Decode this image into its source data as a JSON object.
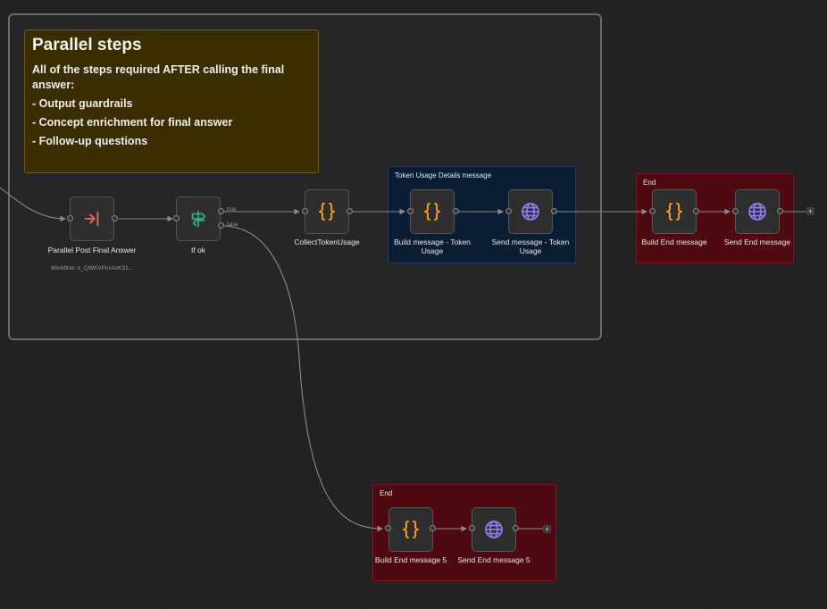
{
  "sticky": {
    "title": "Parallel steps",
    "description": "All of the steps required AFTER calling the final answer:",
    "items": [
      "- Output guardrails",
      "- Concept enrichment for final answer",
      "- Follow-up questions"
    ]
  },
  "groups": {
    "token_usage": "Token Usage Details message",
    "end_1": "End",
    "end_2": "End"
  },
  "nodes": {
    "parallel_post": {
      "label": "Parallel Post Final Answer",
      "sub": "Workflow: k_QWKVPcxAcK31..."
    },
    "if_ok": {
      "label": "If ok",
      "true_label": "true",
      "false_label": "false"
    },
    "collect_token": {
      "label": "CollectTokenUsage"
    },
    "build_token": {
      "label": "Build message - Token Usage"
    },
    "send_token": {
      "label": "Send message - Token Usage"
    },
    "build_end": {
      "label": "Build End message"
    },
    "send_end": {
      "label": "Send End message"
    },
    "build_end5": {
      "label": "Build End message 5"
    },
    "send_end5": {
      "label": "Send End message 5"
    }
  },
  "plus_symbol": "+",
  "colors": {
    "code_icon": "#f39b26",
    "http_icon": "#8f7cf0",
    "workflow_icon": "#f0645a",
    "if_icon": "#2ab07a"
  }
}
